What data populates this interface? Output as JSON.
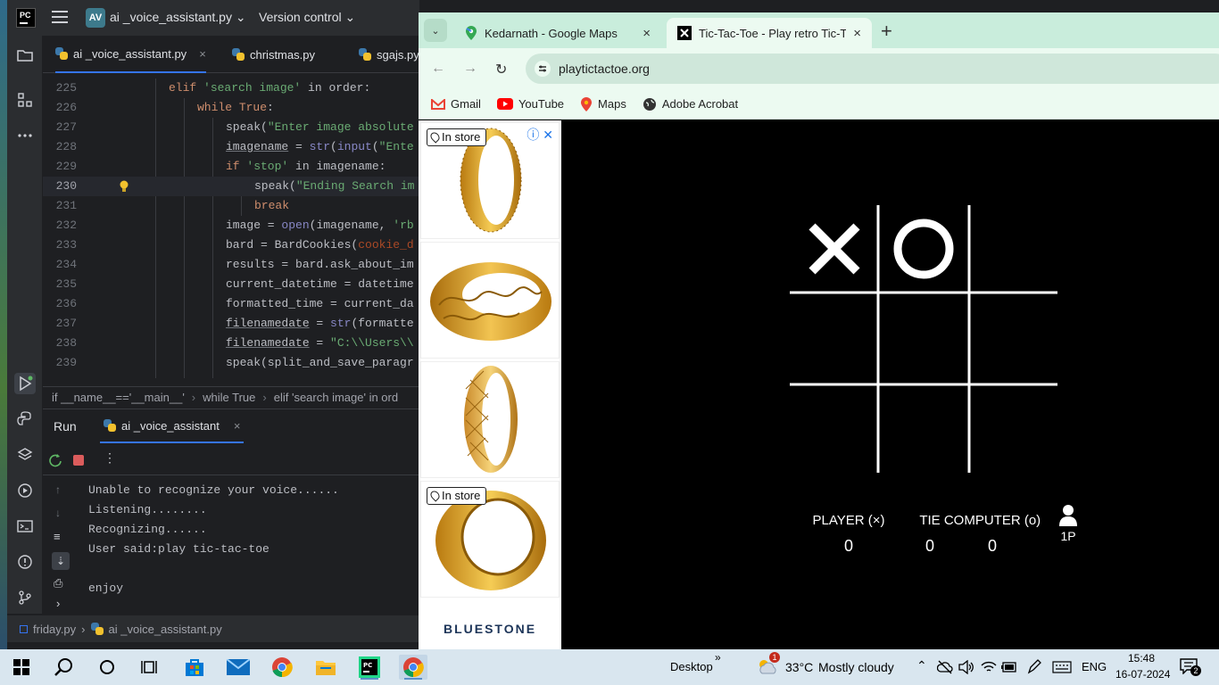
{
  "ide": {
    "logo": "PC",
    "project_badge": "AV",
    "project_name": "ai _voice_assistant.py",
    "vcs_label": "Version control",
    "editor_tabs": [
      {
        "label": "ai _voice_assistant.py",
        "close": "×"
      },
      {
        "label": "christmas.py"
      },
      {
        "label": "sgajs.py"
      }
    ],
    "code_lines": [
      {
        "n": "225"
      },
      {
        "n": "226"
      },
      {
        "n": "227"
      },
      {
        "n": "228"
      },
      {
        "n": "229"
      },
      {
        "n": "230"
      },
      {
        "n": "231"
      },
      {
        "n": "232"
      },
      {
        "n": "233"
      },
      {
        "n": "234"
      },
      {
        "n": "235"
      },
      {
        "n": "236"
      },
      {
        "n": "237"
      },
      {
        "n": "238"
      },
      {
        "n": "239"
      }
    ],
    "code": {
      "l225a": "elif ",
      "l225b": "'search image'",
      "l225c": " in order:",
      "l226a": "while ",
      "l226b": "True",
      "l226c": ":",
      "l227a": "speak(",
      "l227b": "\"Enter image absolute",
      "l228a": "imagename",
      "l228b": " = ",
      "l228c": "str",
      "l228d": "(",
      "l228e": "input",
      "l228f": "(",
      "l228g": "\"Ente",
      "l229a": "if ",
      "l229b": "'stop'",
      "l229c": " in imagename:",
      "l230a": "speak(",
      "l230b": "\"Ending Search im",
      "l231a": "break",
      "l232a": "image = ",
      "l232b": "open",
      "l232c": "(imagename, ",
      "l232d": "'rb",
      "l233a": "bard = BardCookies(",
      "l233b": "cookie_d",
      "l234a": "results = bard.ask_about_im",
      "l235a": "current_datetime = datetime",
      "l236a": "formatted_time = current_da",
      "l237a": "filenamedate",
      "l237b": " = ",
      "l237c": "str",
      "l237d": "(formatte",
      "l238a": "filenamedate",
      "l238b": " = ",
      "l238c": "\"C:\\\\Users\\\\",
      "l239a": "speak(split_and_save_paragr"
    },
    "breadcrumb": [
      "if __name__=='__main__'",
      "while True",
      "elif 'search image' in ord"
    ],
    "run": {
      "title": "Run",
      "tab_label": "ai _voice_assistant",
      "tab_close": "×",
      "output": [
        "Unable to recognize your voice......",
        "Listening........",
        "Recognizing......",
        "User said:play tic-tac-toe",
        "",
        "enjoy"
      ]
    },
    "status_path": [
      "friday.py",
      "ai _voice_assistant.py"
    ]
  },
  "browser": {
    "tabs": [
      {
        "title": "Kedarnath - Google Maps",
        "close": "×"
      },
      {
        "title": "Tic-Tac-Toe - Play retro Tic-Tac-",
        "close": "×",
        "active": true
      }
    ],
    "new_tab": "+",
    "url": "playtictactoe.org",
    "bookmarks": [
      "Gmail",
      "YouTube",
      "Maps",
      "Adobe Acrobat"
    ],
    "ad": {
      "badge": "In store",
      "badge2": "In store",
      "close": "✕",
      "brand": "BLUESTONE"
    },
    "game": {
      "board": [
        "X",
        "O",
        "",
        "",
        "",
        "",
        "",
        "",
        ""
      ],
      "player_label": "PLAYER (×)",
      "player_score": "0",
      "tie_label": "TIE",
      "tie_score": "0",
      "computer_label": "COMPUTER (o)",
      "computer_score": "0",
      "mode": "1P"
    }
  },
  "taskbar": {
    "desktop_label": "Desktop",
    "weather_temp": "33°C",
    "weather_text": "Mostly cloudy",
    "weather_badge": "1",
    "language": "ENG",
    "time": "15:48",
    "date": "16-07-2024",
    "notification_count": "2"
  }
}
